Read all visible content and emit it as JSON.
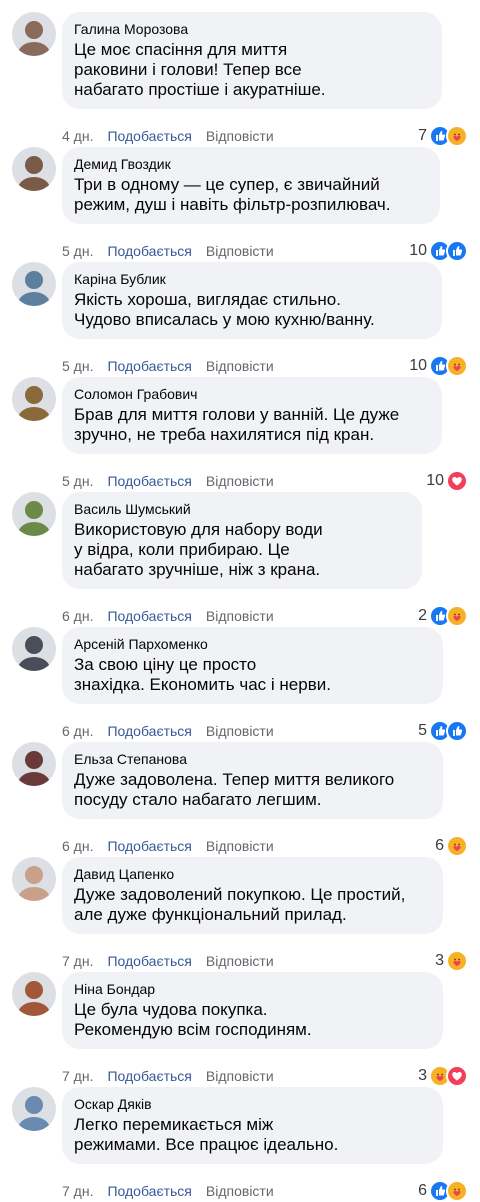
{
  "labels": {
    "like": "Подобається",
    "reply": "Відповісти"
  },
  "colors": {
    "like_blue": "#1877f2",
    "love_red": "#f33e58",
    "care_yellow": "#f7b125",
    "link_blue": "#385898"
  },
  "comments": [
    {
      "author": "Галина Морозова",
      "text": "Це моє спасіння для миття\nраковини і голови! Тепер все\nнабагато простіше і акуратніше.",
      "time": "4 дн.",
      "count": "7",
      "reactions": [
        "like",
        "care"
      ],
      "avatar_color": "#8a6a5a"
    },
    {
      "author": "Демид Гвоздик",
      "text": "Три в одному — це супер, є звичайний\nрежим, душ і навіть фільтр-розпилювач.",
      "time": "5 дн.",
      "count": "10",
      "reactions": [
        "like",
        "like"
      ],
      "avatar_color": "#7a5a48"
    },
    {
      "author": "Каріна Бублик",
      "text": "Якість хороша, виглядає стильно.\nЧудово вписалась у мою кухню/ванну.",
      "time": "5 дн.",
      "count": "10",
      "reactions": [
        "like",
        "care"
      ],
      "avatar_color": "#5d7f9e"
    },
    {
      "author": "Соломон Грабович",
      "text": "Брав для миття голови у ванній. Це дуже\nзручно, не треба нахилятися під кран.",
      "time": "5 дн.",
      "count": "10",
      "reactions": [
        "love"
      ],
      "avatar_color": "#8a6a3a"
    },
    {
      "author": "Василь Шумський",
      "text": "Використовую для набору води\nу відра, коли прибираю. Це\nнабагато зручніше, ніж з крана.",
      "time": "6 дн.",
      "count": "2",
      "reactions": [
        "like",
        "care"
      ],
      "avatar_color": "#6b8a4a"
    },
    {
      "author": "Арсеній Пархоменко",
      "text": "За свою ціну це просто\nзнахідка. Економить час і нерви.",
      "time": "6 дн.",
      "count": "5",
      "reactions": [
        "like",
        "like"
      ],
      "avatar_color": "#4a4e58"
    },
    {
      "author": "Ельза Степанова",
      "text": "Дуже задоволена. Тепер миття великого\nпосуду стало набагато легшим.",
      "time": "6 дн.",
      "count": "6",
      "reactions": [
        "care"
      ],
      "avatar_color": "#6a3a3a"
    },
    {
      "author": "Давид Цапенко",
      "text": "Дуже задоволений покупкою. Це простий,\nале дуже функціональний прилад.",
      "time": "7 дн.",
      "count": "3",
      "reactions": [
        "care"
      ],
      "avatar_color": "#c9a08a"
    },
    {
      "author": "Ніна Бондар",
      "text": "Це була чудова покупка.\nРекомендую всім господиням.",
      "time": "7 дн.",
      "count": "3",
      "reactions": [
        "care",
        "love"
      ],
      "avatar_color": "#a0573a"
    },
    {
      "author": "Оскар Дяків",
      "text": "Легко перемикається між\nрежимами. Все працює ідеально.",
      "time": "7 дн.",
      "count": "6",
      "reactions": [
        "like",
        "care"
      ],
      "avatar_color": "#6a8ab0"
    }
  ]
}
